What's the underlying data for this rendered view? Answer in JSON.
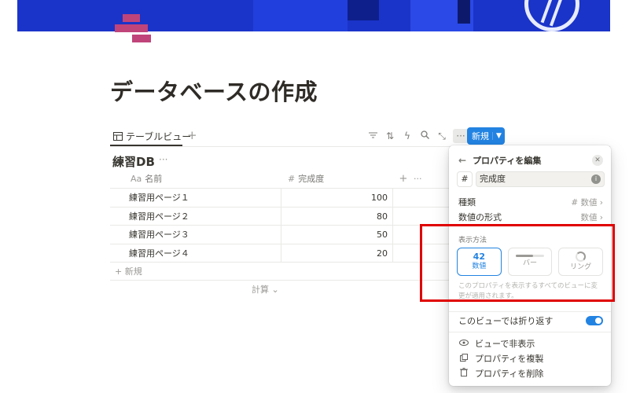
{
  "page": {
    "title": "データベースの作成"
  },
  "viewbar": {
    "tab_icon": "table-icon",
    "tab_label": "テーブルビュー",
    "add": "+",
    "tools": [
      "filter-icon",
      "sort-icon",
      "lightning-icon",
      "search-icon",
      "expand-icon",
      "more-icon"
    ],
    "new_label": "新規"
  },
  "database": {
    "title": "練習DB",
    "more": "···",
    "columns": [
      {
        "icon": "Aa",
        "label": "名前"
      },
      {
        "icon": "#",
        "label": "完成度"
      }
    ],
    "add_column": "+",
    "column_more": "···",
    "rows": [
      {
        "name": "練習用ページ１",
        "value": "100"
      },
      {
        "name": "練習用ページ２",
        "value": "80"
      },
      {
        "name": "練習用ページ３",
        "value": "50"
      },
      {
        "name": "練習用ページ４",
        "value": "20"
      }
    ],
    "add_row": "+ 新規",
    "calc": "計算 ⌄"
  },
  "panel": {
    "title": "プロパティを編集",
    "name_prefix": "#",
    "name_value": "完成度",
    "type_label": "種類",
    "type_value": "# 数値 ›",
    "format_label": "数値の形式",
    "format_value": "数値 ›",
    "display_section": "表示方法",
    "options": [
      {
        "big": "42",
        "label": "数値",
        "selected": true
      },
      {
        "label": "バー"
      },
      {
        "label": "リング"
      }
    ],
    "note": "このプロパティを表示するすべてのビューに変更が適用されます。",
    "wrap_label": "このビューでは折り返す",
    "wrap_on": true,
    "actions": [
      {
        "icon": "eye-icon",
        "label": "ビューで非表示"
      },
      {
        "icon": "duplicate-icon",
        "label": "プロパティを複製"
      },
      {
        "icon": "trash-icon",
        "label": "プロパティを削除"
      }
    ]
  },
  "colors": {
    "accent": "#2383e2",
    "highlight": "#e00000",
    "icon": "#c0447a",
    "cover": "#1a34c9"
  }
}
